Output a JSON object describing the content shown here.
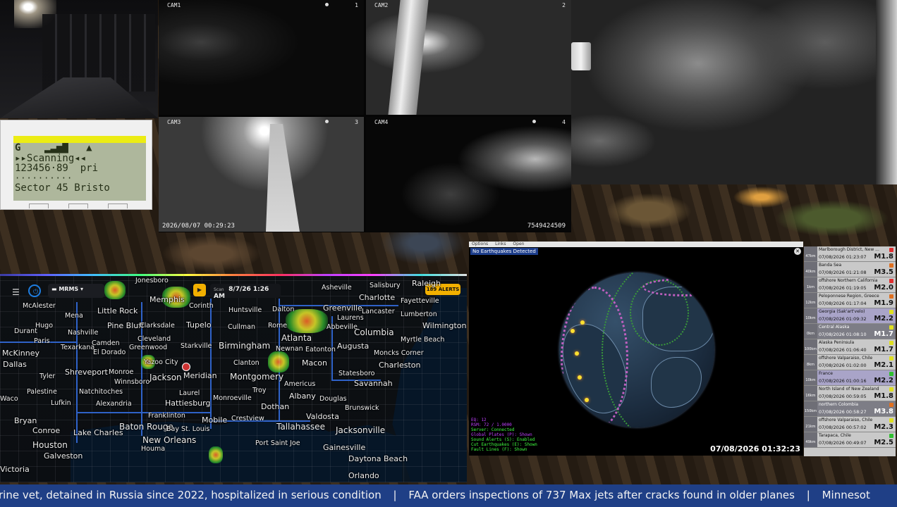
{
  "cams": {
    "cam1": {
      "label": "CAM1",
      "num": "1"
    },
    "cam2": {
      "label": "CAM2",
      "num": "2"
    },
    "cam3": {
      "label": "CAM3",
      "num": "3"
    },
    "cam4": {
      "label": "CAM4",
      "num": "4"
    },
    "timestamp": "2026/08/07  00:29:23",
    "serial": "7549424509"
  },
  "scanner": {
    "line1": "G    ▂▃▅▇   ▲",
    "line2": "▸▸Scanning◂◂",
    "line3": "123456·89  pri",
    "line4": "··········",
    "line5": "Sector 45 Bristo"
  },
  "radar": {
    "product": "MRMS",
    "scan_label": "Scan",
    "time": "8/7/26 1:26 AM",
    "alerts": "189 ALERTS",
    "cities": {
      "raleigh": "Raleigh",
      "jonesboro": "Jonesboro",
      "salisbury": "Salisbury",
      "asheville": "Asheville",
      "memphis": "Memphis",
      "corinth": "Corinth",
      "huntsville": "Huntsville",
      "dalton": "Dalton",
      "greenville": "Greenville",
      "charlotte": "Charlotte",
      "fayetteville": "Fayetteville",
      "mcalester": "McAlester",
      "mena": "Mena",
      "little_rock": "Little Rock",
      "lancaster": "Lancaster",
      "lumberton": "Lumberton",
      "laurens": "Laurens",
      "durant": "Durant",
      "hugo": "Hugo",
      "nashville": "Nashville",
      "pine_bluff": "Pine Bluff",
      "clarksdale": "Clarksdale",
      "tupelo": "Tupelo",
      "cullman": "Cullman",
      "rome": "Rome",
      "abbeville": "Abbeville",
      "columbia": "Columbia",
      "wilmington": "Wilmington",
      "paris": "Paris",
      "camden": "Camden",
      "cleveland": "Cleveland",
      "texarkana": "Texarkana",
      "greenwood": "Greenwood",
      "starkville": "Starkville",
      "birmingham": "Birmingham",
      "atlanta": "Atlanta",
      "augusta": "Augusta",
      "myrtle_beach": "Myrtle Beach",
      "mckinney": "McKinney",
      "el_dorado": "El Dorado",
      "eatonton": "Eatonton",
      "newnan": "Newnan",
      "moncks_corner": "Moncks Corner",
      "dallas": "Dallas",
      "yazoo_city": "Yazoo City",
      "clanton": "Clanton",
      "macon": "Macon",
      "charleston": "Charleston",
      "tyler": "Tyler",
      "shreveport": "Shreveport",
      "monroe": "Monroe",
      "jackson": "Jackson",
      "meridian": "Meridian",
      "montgomery": "Montgomery",
      "statesboro": "Statesboro",
      "winnsboro": "Winnsboro",
      "troy": "Troy",
      "americus": "Americus",
      "savannah": "Savannah",
      "palestine": "Palestine",
      "natchitoches": "Natchitoches",
      "laurel": "Laurel",
      "albany": "Albany",
      "douglas": "Douglas",
      "waco": "Waco",
      "lufkin": "Lufkin",
      "alexandria": "Alexandria",
      "hattiesburg": "Hattiesburg",
      "monroeville": "Monroeville",
      "dothan": "Dothan",
      "brunswick": "Brunswick",
      "franklinton": "Franklinton",
      "valdosta": "Valdosta",
      "bryan": "Bryan",
      "crestview": "Crestview",
      "baton_rouge": "Baton Rouge",
      "mobile": "Mobile",
      "tallahassee": "Tallahassee",
      "jacksonville": "Jacksonville",
      "conroe": "Conroe",
      "lake_charles": "Lake Charles",
      "bay_st_louis": "Bay St. Louis",
      "new_orleans": "New Orleans",
      "port_saint_joe": "Port Saint Joe",
      "houston": "Houston",
      "gainesville": "Gainesville",
      "houma": "Houma",
      "galveston": "Galveston",
      "daytona_beach": "Daytona Beach",
      "victoria": "Victoria",
      "orlando": "Orlando",
      "nashville_tn": "Nashville"
    }
  },
  "quake": {
    "menu": [
      "Options",
      "Links",
      "Open"
    ],
    "status": "No Earthquakes Detected",
    "stats": [
      {
        "text": "EQ: 12",
        "color": "#c040ff"
      },
      {
        "text": "RSM: 72 / 1.0000",
        "color": "#c040ff"
      },
      {
        "text": "Server: Connected",
        "color": "#40ff40"
      },
      {
        "text": "Global Plates (P): Shown",
        "color": "#c040ff"
      },
      {
        "text": "Sound Alerts (S): Enabled",
        "color": "#40ff40"
      },
      {
        "text": "Cut Earthquakes (E): Shown",
        "color": "#40ff40"
      },
      {
        "text": "Fault Lines (F): Shown",
        "color": "#40ff40"
      }
    ],
    "clock": "07/08/2026 01:32:23",
    "list": [
      {
        "side": "47km",
        "place": "Marlborough District, New ...",
        "when": "07/08/2026 01:23:07",
        "mag": "M1.8",
        "flag": "#e03030",
        "style": ""
      },
      {
        "side": "40km",
        "place": "Banda Sea",
        "when": "07/08/2026 01:21:08",
        "mag": "M3.5",
        "flag": "#e07020",
        "style": ""
      },
      {
        "side": "1km",
        "place": "offshore Northern California",
        "when": "07/08/2026 01:19:05",
        "mag": "M2.0",
        "flag": "#e03030",
        "style": ""
      },
      {
        "side": "12km",
        "place": "Peloponnese Region, Greece",
        "when": "07/08/2026 01:17:04",
        "mag": "M1.9",
        "flag": "#e07020",
        "style": ""
      },
      {
        "side": "10km",
        "place": "Georgia (Sak'art'velo)",
        "when": "07/08/2026 01:09:32",
        "mag": "M2.2",
        "flag": "#e0e020",
        "style": "hl"
      },
      {
        "side": "0km",
        "place": "Central Alaska",
        "when": "07/08/2026 01:08:10",
        "mag": "M1.7",
        "flag": "#e0e020",
        "style": "dark"
      },
      {
        "side": "100km",
        "place": "Alaska Peninsula",
        "when": "07/08/2026 01:06:40",
        "mag": "M1.7",
        "flag": "#e0e020",
        "style": ""
      },
      {
        "side": "8km",
        "place": "offshore Valparaiso, Chile",
        "when": "07/08/2026 01:02:00",
        "mag": "M2.1",
        "flag": "#e0e020",
        "style": ""
      },
      {
        "side": "10km",
        "place": "France",
        "when": "07/08/2026 01:00:16",
        "mag": "M2.2",
        "flag": "#30c030",
        "style": "hl"
      },
      {
        "side": "16km",
        "place": "North Island of New Zealand",
        "when": "07/08/2026 00:59:05",
        "mag": "M1.8",
        "flag": "#e0e020",
        "style": ""
      },
      {
        "side": "150km",
        "place": "northern Colombia",
        "when": "07/08/2026 00:58:27",
        "mag": "M3.8",
        "flag": "#e07020",
        "style": "dark"
      },
      {
        "side": "21km",
        "place": "offshore Valparaiso, Chile",
        "when": "07/08/2026 00:57:02",
        "mag": "M2.3",
        "flag": "#e0e020",
        "style": ""
      },
      {
        "side": "49km",
        "place": "Tarapaca, Chile",
        "when": "07/08/2026 00:49:07",
        "mag": "M2.5",
        "flag": "#30c030",
        "style": ""
      }
    ]
  },
  "ticker": {
    "item1": "rine vet, detained in Russia since 2022, hospitalized in serious condition",
    "sep": "|",
    "item2": "FAA orders inspections of 737 Max jets after cracks found in older planes",
    "item3": "Minnesot"
  }
}
